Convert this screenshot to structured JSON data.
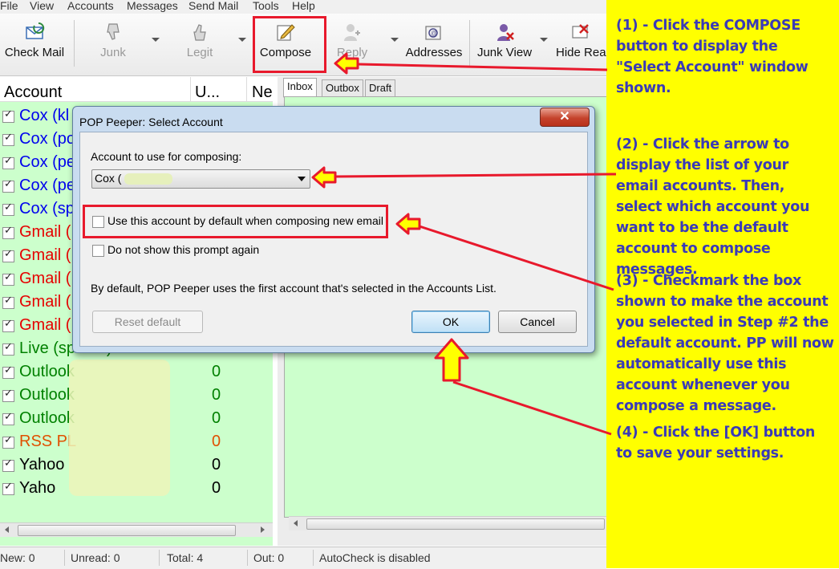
{
  "menu": [
    "File",
    "View",
    "Accounts",
    "Messages",
    "Send Mail",
    "Tools",
    "Help"
  ],
  "toolbar": {
    "check_mail": "Check Mail",
    "junk": "Junk",
    "legit": "Legit",
    "compose": "Compose",
    "reply": "Reply",
    "addresses": "Addresses",
    "junk_view": "Junk View",
    "hide_read": "Hide Read"
  },
  "accounts": {
    "columns": [
      "Account",
      "U...",
      "Ne"
    ],
    "rows": [
      {
        "name": "Cox (kl",
        "count": "",
        "color": "#0000ee"
      },
      {
        "name": "Cox (po",
        "count": "",
        "color": "#0000ee"
      },
      {
        "name": "Cox (pe",
        "count": "",
        "color": "#0000ee"
      },
      {
        "name": "Cox (pe",
        "count": "",
        "color": "#0000ee"
      },
      {
        "name": "Cox (sp",
        "count": "",
        "color": "#0000ee"
      },
      {
        "name": "Gmail (",
        "count": "",
        "color": "#e60000"
      },
      {
        "name": "Gmail (",
        "count": "",
        "color": "#e60000"
      },
      {
        "name": "Gmail (",
        "count": "",
        "color": "#e60000"
      },
      {
        "name": "Gmail (",
        "count": "",
        "color": "#e60000"
      },
      {
        "name": "Gmail (",
        "count": "",
        "color": "#e60000"
      },
      {
        "name": "Live (spesrd)",
        "count": "0",
        "color": "#008000"
      },
      {
        "name": "Outlook",
        "count": "0",
        "color": "#008000"
      },
      {
        "name": "Outlook",
        "count": "0",
        "color": "#008000"
      },
      {
        "name": "Outlook",
        "count": "0",
        "color": "#008000"
      },
      {
        "name": "RSS PL",
        "count": "0",
        "color": "#e05000"
      },
      {
        "name": "Yahoo",
        "count": "0",
        "color": "#000000"
      },
      {
        "name": "Yaho",
        "count": "0",
        "color": "#000000"
      }
    ]
  },
  "tabs": [
    "Inbox",
    "Outbox",
    "Draft"
  ],
  "dialog": {
    "title": "POP Peeper: Select Account",
    "close": "✕",
    "account_label": "Account to use for composing:",
    "account_value": "Cox (",
    "default_checkbox": "Use this account by default when composing new email",
    "noprompt_checkbox": "Do not show this prompt again",
    "info": "By default, POP Peeper uses the first account that's selected in the Accounts List.",
    "reset_button": "Reset default",
    "ok_button": "OK",
    "cancel_button": "Cancel"
  },
  "status": {
    "new": "New: 0",
    "unread": "Unread: 0",
    "total": "Total: 4",
    "out": "Out: 0",
    "autocheck": "AutoCheck is disabled"
  },
  "instructions": {
    "step1": "(1) - Click the COMPOSE button to display the \"Select Account\" window shown.",
    "step2": "(2) - Click the arrow to display the list of your email accounts.  Then, select which account you want to be the default account to compose messages.",
    "step3": "(3) - Checkmark the box shown to make the account you selected in Step #2 the default account.  PP will now automatically use this account whenever you compose a message.",
    "step4": "(4) - Click the [OK] button to save your settings."
  },
  "colors": {
    "highlight": "#e8192c",
    "panel": "#ffff00",
    "instruction_text": "#3a3ab8",
    "list_bg": "#ccffcc"
  }
}
